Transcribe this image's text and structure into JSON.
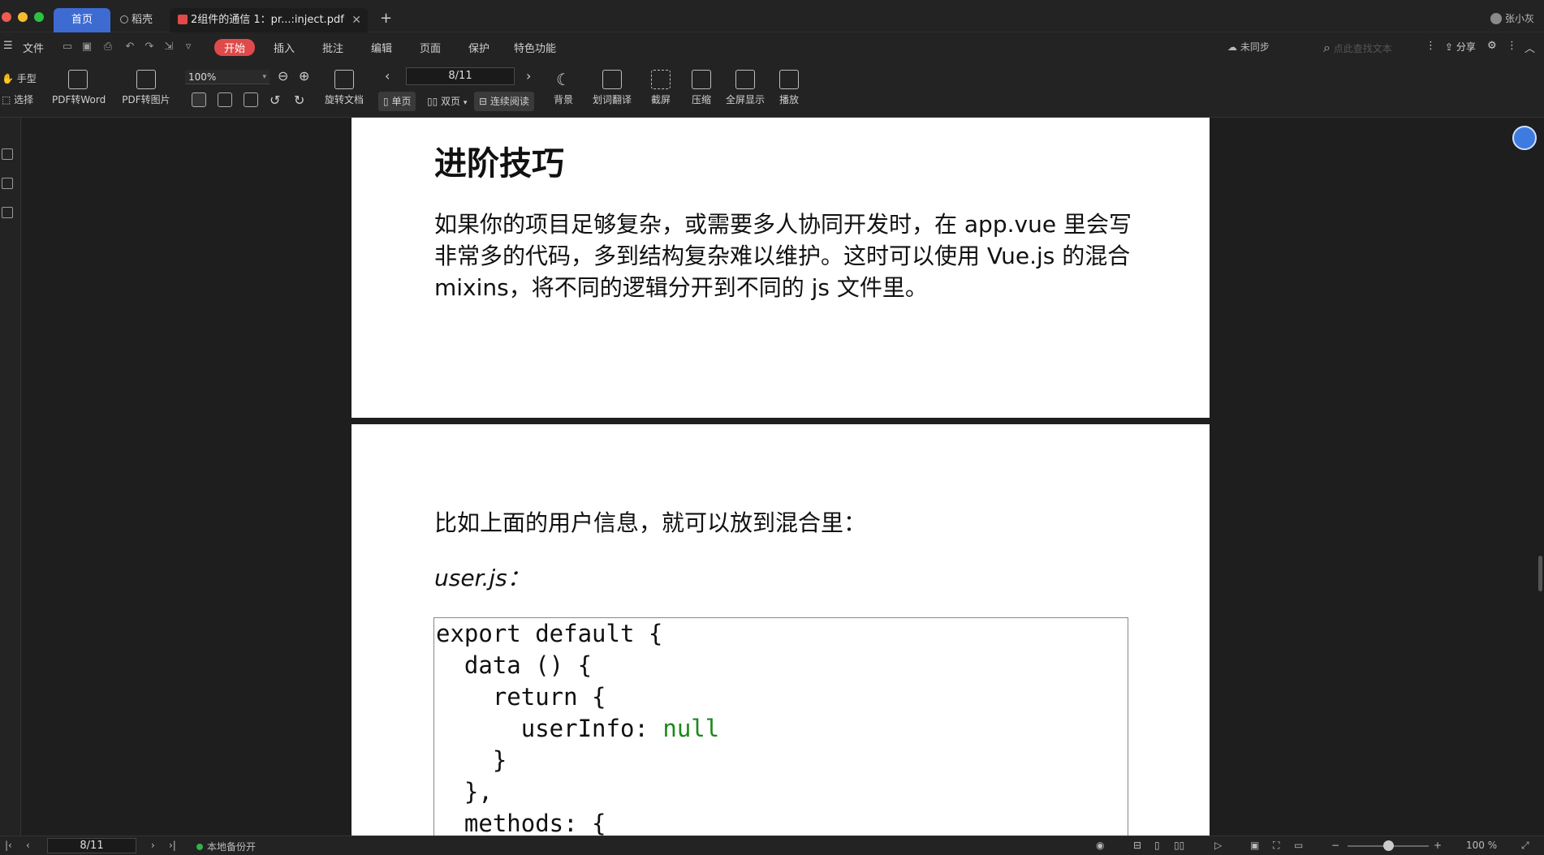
{
  "titlebar": {
    "tabs": [
      {
        "label": "首页"
      },
      {
        "label": "稻壳"
      },
      {
        "label": "2组件的通信 1：pr...:inject.pdf"
      }
    ],
    "user_name": "张小灰"
  },
  "menu": {
    "file": "文件",
    "items": [
      "开始",
      "插入",
      "批注",
      "编辑",
      "页面",
      "保护",
      "特色功能"
    ],
    "sync_status": "未同步",
    "search_placeholder": "点此查找文本",
    "share": "分享"
  },
  "toolbar": {
    "hand": "手型",
    "select": "选择",
    "pdf_to_word": "PDF转Word",
    "pdf_to_image": "PDF转图片",
    "zoom": "100%",
    "rotate_doc": "旋转文档",
    "page_indicator": "8/11",
    "single_page": "单页",
    "double_page": "双页",
    "continuous": "连续阅读",
    "background": "背景",
    "translate": "划词翻译",
    "screenshot": "截屏",
    "compress": "压缩",
    "fullscreen": "全屏显示",
    "play": "播放"
  },
  "document": {
    "heading": "进阶技巧",
    "paragraph1": "如果你的项目足够复杂，或需要多人协同开发时，在 app.vue 里会写非常多的代码，多到结构复杂难以维护。这时可以使用 Vue.js 的混合 mixins，将不同的逻辑分开到不同的 js 文件里。",
    "paragraph2": "比如上面的用户信息，就可以放到混合里：",
    "code_caption": "user.js：",
    "code_lines": [
      "export default {",
      "  data () {",
      "    return {",
      "      userInfo: ",
      "    }",
      "  },",
      "  methods: {"
    ],
    "null_token": "null"
  },
  "statusbar": {
    "page": "8/11",
    "backup": "本地备份开",
    "zoom": "100 %"
  },
  "colors": {
    "accent_blue": "#3d6bd2",
    "start_red": "#e04a4a",
    "backup_green": "#2fb34a",
    "code_null_green": "#1a8a1a"
  }
}
